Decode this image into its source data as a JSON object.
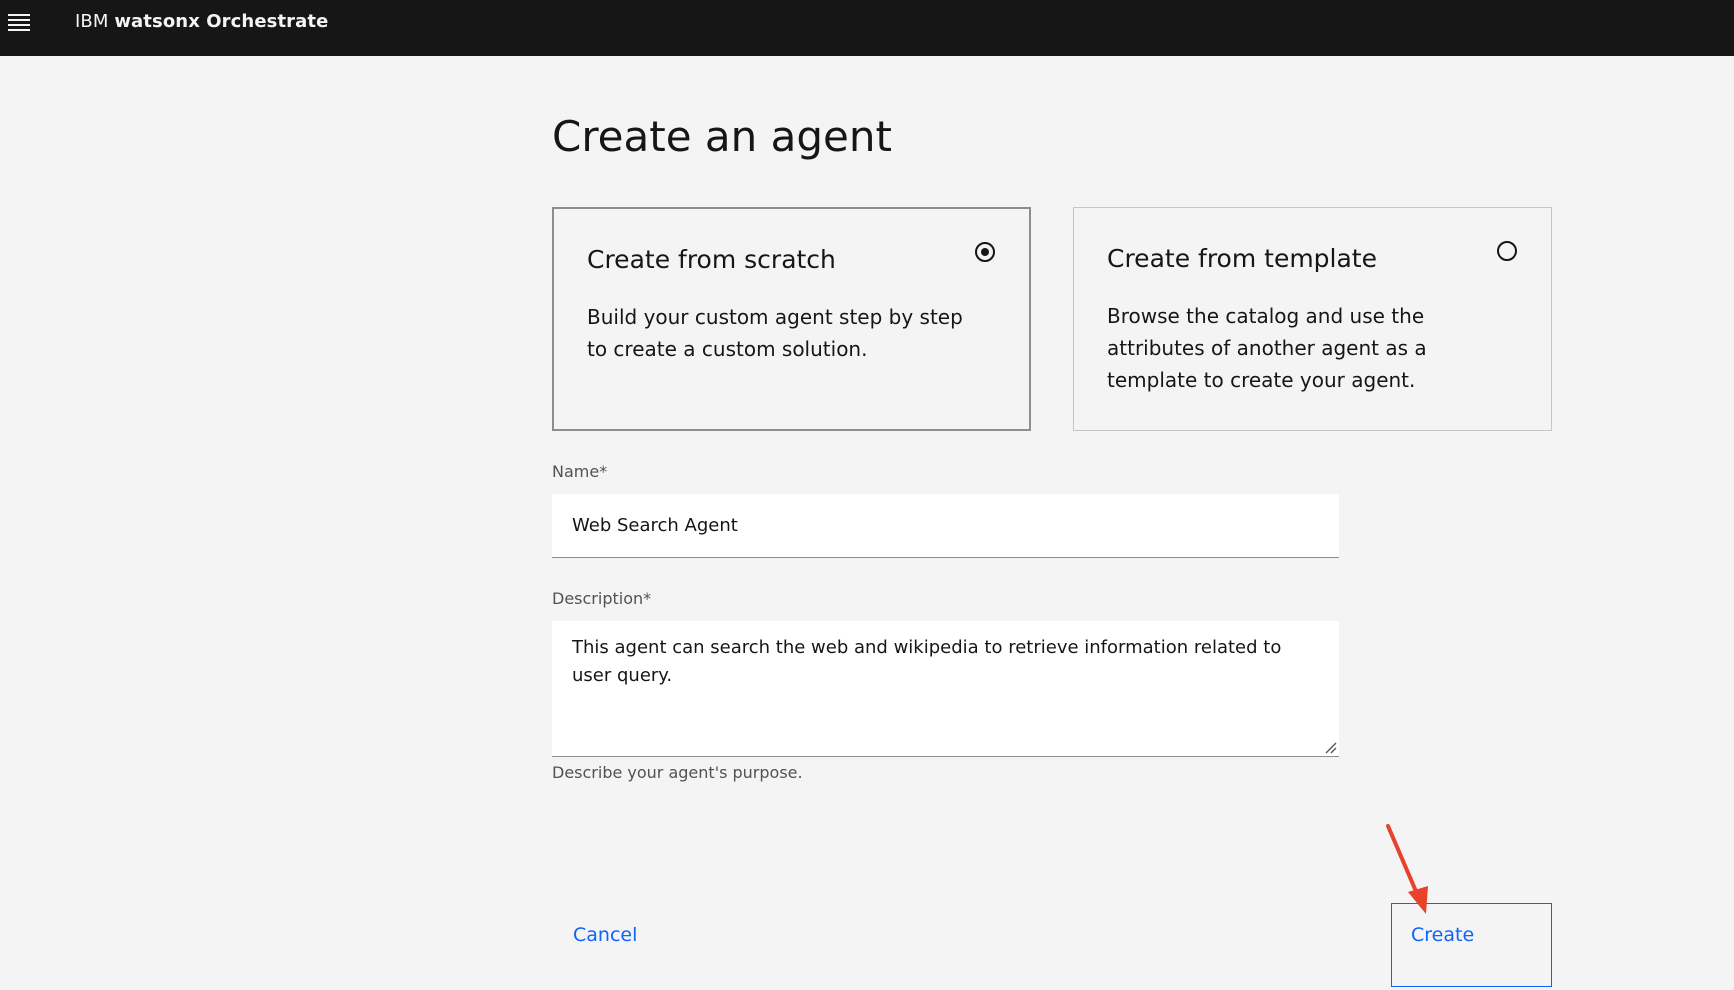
{
  "header": {
    "brand_prefix": "IBM",
    "brand_product": "watsonx Orchestrate",
    "menu_icon": "hamburger-menu-icon"
  },
  "page": {
    "title": "Create an agent"
  },
  "options": [
    {
      "title": "Create from scratch",
      "description": "Build your custom agent step by step to create a custom solution.",
      "selected": true
    },
    {
      "title": "Create from template",
      "description": "Browse the catalog and use the attributes of another agent as a template to create your agent.",
      "selected": false
    }
  ],
  "form": {
    "name_label": "Name*",
    "name_value": "Web Search Agent",
    "description_label": "Description*",
    "description_value": "This agent can search the web and wikipedia to retrieve information related to user query.",
    "description_helper": "Describe your agent's purpose."
  },
  "actions": {
    "cancel_label": "Cancel",
    "create_label": "Create"
  },
  "colors": {
    "header_bg": "#161616",
    "page_bg": "#f4f4f4",
    "link_blue": "#0f62fe",
    "annotation_red": "#e8412c"
  }
}
